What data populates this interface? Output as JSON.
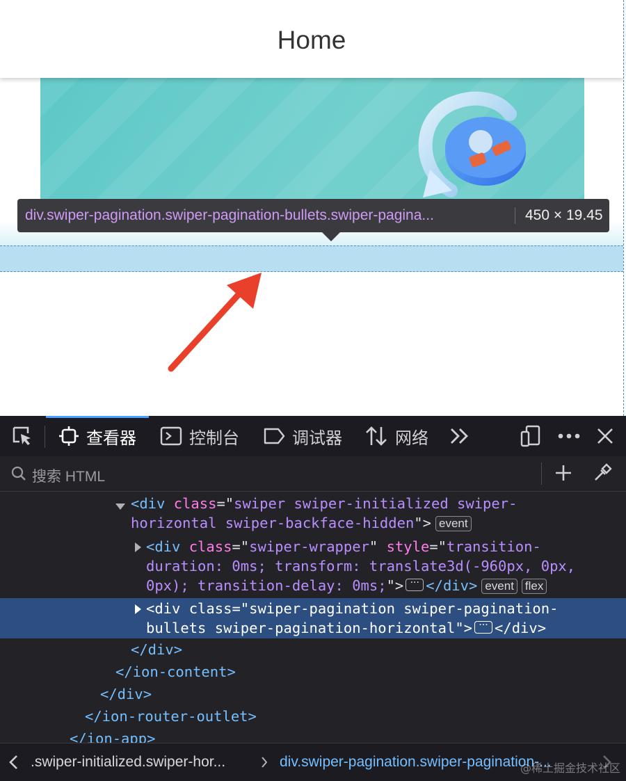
{
  "app": {
    "title": "Home"
  },
  "inspector_tooltip": {
    "selector": "div.swiper-pagination.swiper-pagination-bullets.swiper-pagina...",
    "size": "450 × 19.45"
  },
  "devtools": {
    "tabs": [
      {
        "label": "查看器",
        "icon": "inspector-icon",
        "active": true
      },
      {
        "label": "控制台",
        "icon": "console-icon",
        "active": false
      },
      {
        "label": "调试器",
        "icon": "debugger-icon",
        "active": false
      },
      {
        "label": "网络",
        "icon": "network-icon",
        "active": false
      }
    ],
    "search_placeholder": "搜索 HTML",
    "tree": {
      "r1_open": "<div ",
      "r1_attr": "class",
      "r1_eq": "=\"",
      "r1_val_a": "swiper swiper-initialized swiper-",
      "r1_val_b": "horizontal swiper-backface-hidden",
      "r1_close": "\">",
      "r1_badge": "event",
      "r2_open": "<div ",
      "r2_attr1": "class",
      "r2_val1": "swiper-wrapper",
      "r2_attr2": "style",
      "r2_val_a": "transition-",
      "r2_val_b": "duration: 0ms; transform: translate3d(-960px, 0px,",
      "r2_val_c": "0px); transition-delay: 0ms;",
      "r2_end": "</div>",
      "r2_badge1": "event",
      "r2_badge2": "flex",
      "r3_open": "<div ",
      "r3_attr": "class",
      "r3_val_a": "swiper-pagination swiper-pagination-",
      "r3_val_b": "bullets swiper-pagination-horizontal",
      "r3_end": "</div>",
      "c1": "</div>",
      "c2": "</ion-content>",
      "c3": "</div>",
      "c4": "</ion-router-outlet>",
      "c5": "</ion-app>"
    },
    "breadcrumbs": [
      ".swiper-initialized.swiper-hor...",
      "div.swiper-pagination.swiper-pagination-..."
    ]
  },
  "watermark": "@稀土掘金技术社区"
}
